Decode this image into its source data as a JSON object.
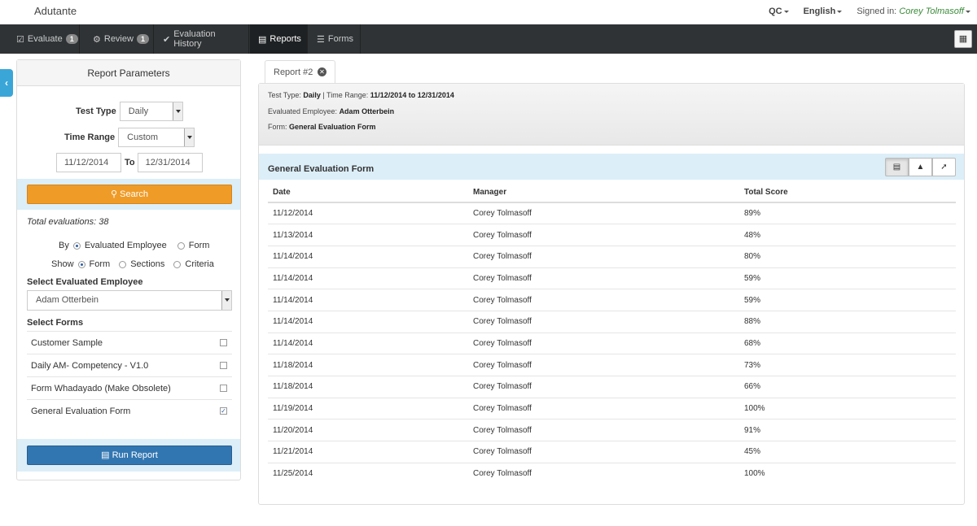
{
  "app": {
    "brand": "Adutante"
  },
  "topbar": {
    "region": "QC",
    "language": "English",
    "signed_in_label": "Signed in:",
    "user": "Corey Tolmasoff"
  },
  "nav": {
    "items": [
      {
        "label": "Evaluate",
        "badge": "1",
        "icon": "check-square-icon"
      },
      {
        "label": "Review",
        "badge": "1",
        "icon": "sitemap-icon"
      },
      {
        "label": "Evaluation History",
        "icon": "checkmark-icon"
      },
      {
        "label": "Reports",
        "icon": "bar-chart-icon",
        "active": true
      },
      {
        "label": "Forms",
        "icon": "list-icon"
      }
    ]
  },
  "params": {
    "title": "Report Parameters",
    "test_type_label": "Test Type",
    "test_type": "Daily",
    "time_range_label": "Time Range",
    "time_range": "Custom",
    "date_from": "11/12/2014",
    "to_label": "To",
    "date_to": "12/31/2014",
    "search_label": "Search",
    "total": "Total evaluations: 38",
    "by_label": "By",
    "by_options": [
      "Evaluated Employee",
      "Form"
    ],
    "by_selected": "Evaluated Employee",
    "show_label": "Show",
    "show_options": [
      "Form",
      "Sections",
      "Criteria"
    ],
    "show_selected": "Form",
    "select_employee_label": "Select Evaluated Employee",
    "employee": "Adam Otterbein",
    "select_forms_label": "Select Forms",
    "forms": [
      {
        "name": "Customer Sample",
        "checked": false
      },
      {
        "name": "Daily AM- Competency - V1.0",
        "checked": false
      },
      {
        "name": "Form Whadayado (Make Obsolete)",
        "checked": false
      },
      {
        "name": "General Evaluation Form",
        "checked": true
      }
    ],
    "run_label": "Run Report"
  },
  "report": {
    "tab_label": "Report #2",
    "test_type_key": "Test Type: ",
    "test_type": "Daily",
    "time_range_key": " | Time Range: ",
    "time_range": "11/12/2014 to 12/31/2014",
    "employee_key": "Evaluated Employee: ",
    "employee": "Adam Otterbein",
    "form_key": "Form: ",
    "form": "General Evaluation Form",
    "section_title": "General Evaluation Form",
    "columns": [
      "Date",
      "Manager",
      "Total Score"
    ],
    "rows": [
      [
        "11/12/2014",
        "Corey Tolmasoff",
        "89%"
      ],
      [
        "11/13/2014",
        "Corey Tolmasoff",
        "48%"
      ],
      [
        "11/14/2014",
        "Corey Tolmasoff",
        "80%"
      ],
      [
        "11/14/2014",
        "Corey Tolmasoff",
        "59%"
      ],
      [
        "11/14/2014",
        "Corey Tolmasoff",
        "59%"
      ],
      [
        "11/14/2014",
        "Corey Tolmasoff",
        "88%"
      ],
      [
        "11/14/2014",
        "Corey Tolmasoff",
        "68%"
      ],
      [
        "11/18/2014",
        "Corey Tolmasoff",
        "73%"
      ],
      [
        "11/18/2014",
        "Corey Tolmasoff",
        "66%"
      ],
      [
        "11/19/2014",
        "Corey Tolmasoff",
        "100%"
      ],
      [
        "11/20/2014",
        "Corey Tolmasoff",
        "91%"
      ],
      [
        "11/21/2014",
        "Corey Tolmasoff",
        "45%"
      ],
      [
        "11/25/2014",
        "Corey Tolmasoff",
        "100%"
      ]
    ]
  },
  "colors": {
    "navbar": "#2f3336",
    "search_button": "#ef9b28",
    "run_button": "#3276b1",
    "band": "#dceef8",
    "user": "#3a8a3a"
  }
}
